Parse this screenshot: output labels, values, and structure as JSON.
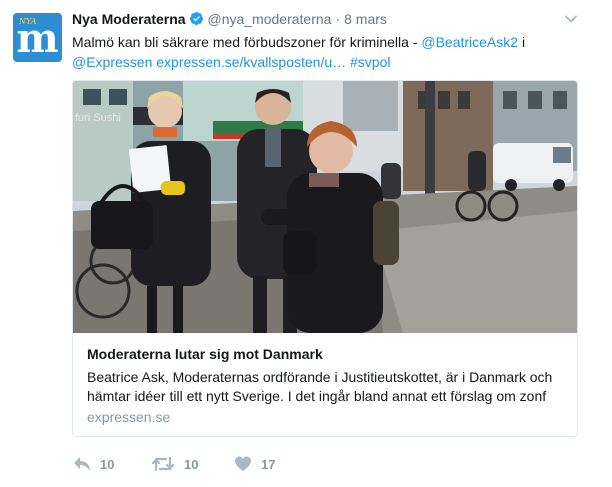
{
  "tweet": {
    "display_name": "Nya Moderaterna",
    "handle": "@nya_moderaterna",
    "separator": "·",
    "date": "8 mars",
    "text_plain": "Malmö kan bli säkrare med förbudszoner för kriminella - ",
    "mention_1": "@BeatriceAsk2",
    "text_mid": " i",
    "mention_2": "@Expressen",
    "link": "expressen.se/kvallsposten/u…",
    "hashtag": "#svpol"
  },
  "avatar": {
    "letter": "m",
    "small_text": "NYA"
  },
  "card": {
    "title": "Moderaterna lutar sig mot Danmark",
    "description": "Beatrice Ask, Moderaternas ordförande i Justitieutskottet, är i Danmark och hämtar idéer till ett nytt Sverige. I det ingår bland annat ett förslag om zonf",
    "domain": "expressen.se",
    "photo_sign_text": "furi Sushi"
  },
  "actions": {
    "reply_count": "10",
    "retweet_count": "10",
    "like_count": "17"
  },
  "colors": {
    "link": "#1b95e0",
    "avatar_bg": "#2d8ed3",
    "muted": "#657786",
    "action_gray": "#8899a6"
  },
  "icons": [
    "verified-badge-icon",
    "chevron-down-icon",
    "reply-icon",
    "retweet-icon",
    "heart-icon"
  ]
}
